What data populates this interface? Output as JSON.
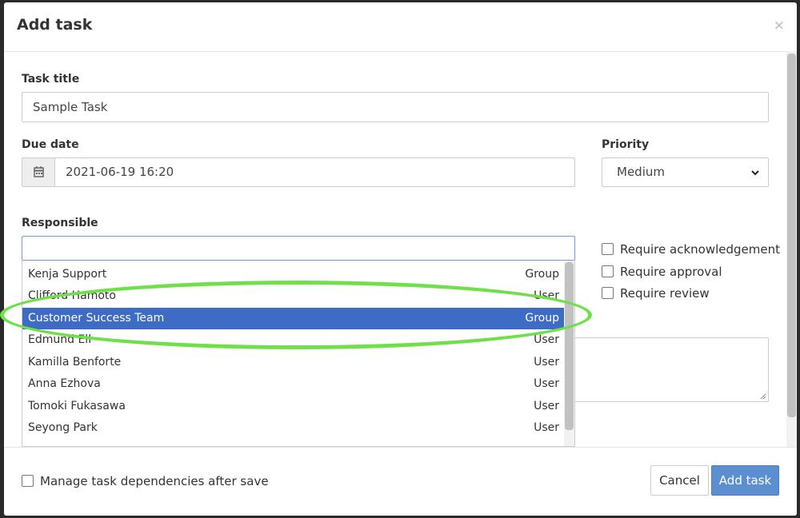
{
  "dialog": {
    "title": "Add task",
    "close_label": "×"
  },
  "task_title": {
    "label": "Task title",
    "value": "Sample Task"
  },
  "due_date": {
    "label": "Due date",
    "value": "2021-06-19 16:20",
    "icon": "calendar-icon"
  },
  "priority": {
    "label": "Priority",
    "value": "Medium",
    "icon": "chevron-down-icon"
  },
  "responsible": {
    "label": "Responsible",
    "search_value": "",
    "options": [
      {
        "name": "Kenja Support",
        "kind": "Group"
      },
      {
        "name": "Clifford Hamoto",
        "kind": "User"
      },
      {
        "name": "Customer Success Team",
        "kind": "Group",
        "selected": true
      },
      {
        "name": "Edmund Ell",
        "kind": "User"
      },
      {
        "name": "Kamilla Benforte",
        "kind": "User"
      },
      {
        "name": "Anna Ezhova",
        "kind": "User"
      },
      {
        "name": "Tomoki Fukasawa",
        "kind": "User"
      },
      {
        "name": "Seyong Park",
        "kind": "User"
      }
    ]
  },
  "options": {
    "require_acknowledgement": "Require acknowledgement",
    "require_approval": "Require approval",
    "require_review": "Require review"
  },
  "footer": {
    "manage_dependencies": "Manage task dependencies after save",
    "cancel_label": "Cancel",
    "submit_label": "Add task"
  },
  "colors": {
    "primary": "#5b8fd0",
    "selected_row": "#3e6bc4",
    "highlight_annotation": "#6fe04a"
  }
}
